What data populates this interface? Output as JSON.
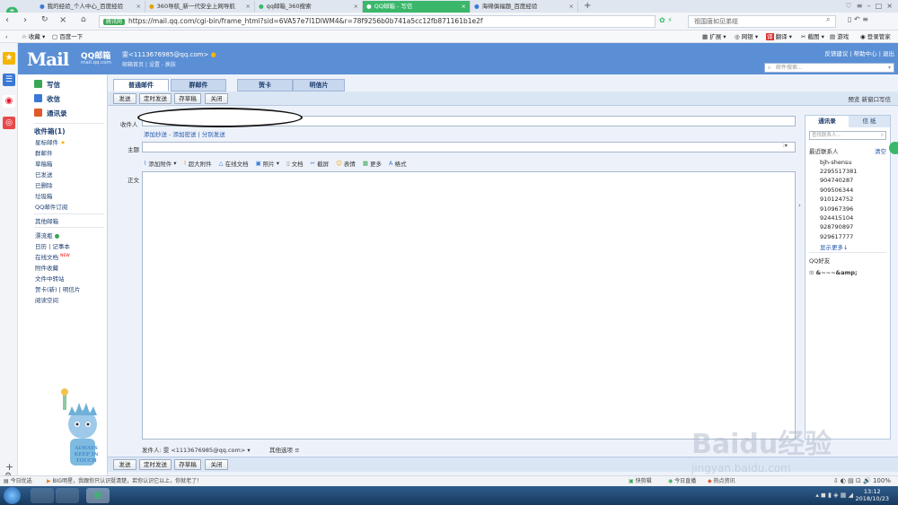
{
  "browser": {
    "tabs": [
      {
        "label": "我的经验_个人中心_百度经验",
        "active": false
      },
      {
        "label": "360导航_新一代安全上网导航",
        "active": false
      },
      {
        "label": "qq邮箱_360搜索",
        "active": false
      },
      {
        "label": "QQ邮箱 - 写信",
        "active": true
      },
      {
        "label": "海绵俱福题_百度经验",
        "active": false
      }
    ],
    "new_tab": "+",
    "security_badge": "腾讯网",
    "url": "https://mail.qq.com/cgi-bin/frame_html?sid=6VA57e7I1DlWM4&r=78f9256b0b741a5cc12fb871161b1e2f",
    "search_placeholder": "祖国唐如见弟缆",
    "bookmarks": {
      "favorites": "收藏",
      "baidu": "百度一下",
      "ext": "扩展",
      "bank": "网银",
      "translate": "翻译",
      "screenshot": "截图",
      "games": "游戏",
      "login": "登录管家"
    }
  },
  "mail": {
    "logo": "Mail",
    "logo_cn": "QQ邮箱",
    "logo_sub": "mail.qq.com",
    "account": "雯<1113676985@qq.com>",
    "account_links": "邮箱首页 | 设置 - 换肤",
    "top_links": "反馈建议 | 帮助中心 | 退出",
    "search_placeholder": "邮件搜索..."
  },
  "nav": {
    "compose": "写信",
    "inbox": "收信",
    "contacts": "通讯录",
    "inbox_count": "收件箱(1)",
    "folders": [
      "星标邮件",
      "群邮件",
      "草稿箱",
      "已发送",
      "已删除",
      "垃圾箱",
      "QQ邮件订阅"
    ],
    "other": "其他邮箱",
    "apps": [
      "漂流瓶",
      "日历 | 记事本",
      "在线文档",
      "附件收藏",
      "文件中转站",
      "贺卡(新) | 明信片",
      "阅读空间"
    ],
    "new_badge": "NEW",
    "mascot": "ALWAYS KEEP IN TOUCH"
  },
  "compose": {
    "tabs": [
      "普通邮件",
      "群邮件",
      "贺卡",
      "明信片"
    ],
    "buttons": {
      "send": "发送",
      "scheduled": "定时发送",
      "draft": "存草稿",
      "close": "关闭"
    },
    "toolbar_right": "预览  新窗口写信",
    "to_label": "收件人",
    "to_links": "添加抄送 - 添加密送 | 分别发送",
    "subject_label": "主题",
    "body_label": "正文",
    "format_items": [
      "添加附件",
      "超大附件",
      "在线文档",
      "照片",
      "文档",
      "截屏",
      "表情",
      "更多",
      "格式"
    ],
    "sender": "发件人: 雯 <1113676985@qq.com>",
    "other_options": "其他选项"
  },
  "contacts_panel": {
    "tabs": [
      "通讯录",
      "信 纸"
    ],
    "search_placeholder": "查找联系人...",
    "recent_label": "最近联系人",
    "clear": "清空",
    "recent": [
      "bjh-shensu",
      "2295517381",
      "904740287",
      "909506344",
      "910124752",
      "910967396",
      "924415104",
      "928790897",
      "929617777"
    ],
    "more": "显示更多↓",
    "friends_label": "QQ好友",
    "friend_group": "&~~~&amp;"
  },
  "status_bar": {
    "left": "今日优选",
    "news": "BIG明星，我跟你只认识挺清楚，若你认识它以上，你就老了！",
    "quick": "快剪辑",
    "live": "今日直播",
    "hot": "热点资讯"
  },
  "taskbar": {
    "time": "13:12",
    "date": "2018/10/23"
  },
  "watermark": {
    "main": "Baidu经验",
    "sub": "jingyan.baidu.com"
  }
}
